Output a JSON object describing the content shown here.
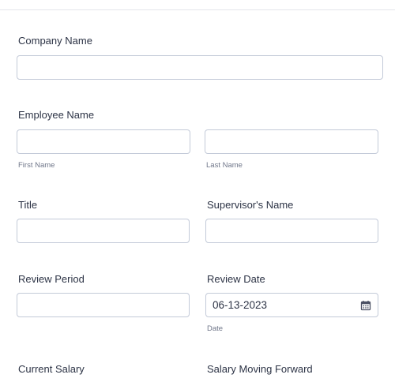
{
  "form": {
    "company": {
      "label": "Company Name",
      "value": ""
    },
    "employee": {
      "label": "Employee Name",
      "first_sublabel": "First Name",
      "last_sublabel": "Last Name",
      "first_value": "",
      "last_value": ""
    },
    "title": {
      "label": "Title",
      "value": ""
    },
    "supervisor": {
      "label": "Supervisor's Name",
      "value": ""
    },
    "review_period": {
      "label": "Review Period",
      "value": ""
    },
    "review_date": {
      "label": "Review Date",
      "value": "06-13-2023",
      "sublabel": "Date",
      "icon": "calendar-icon"
    },
    "current_salary": {
      "label": "Current Salary"
    },
    "salary_forward": {
      "label": "Salary Moving Forward"
    }
  },
  "colors": {
    "text": "#2c3345",
    "sublabel": "#6f7689",
    "border": "#c3cad8"
  }
}
